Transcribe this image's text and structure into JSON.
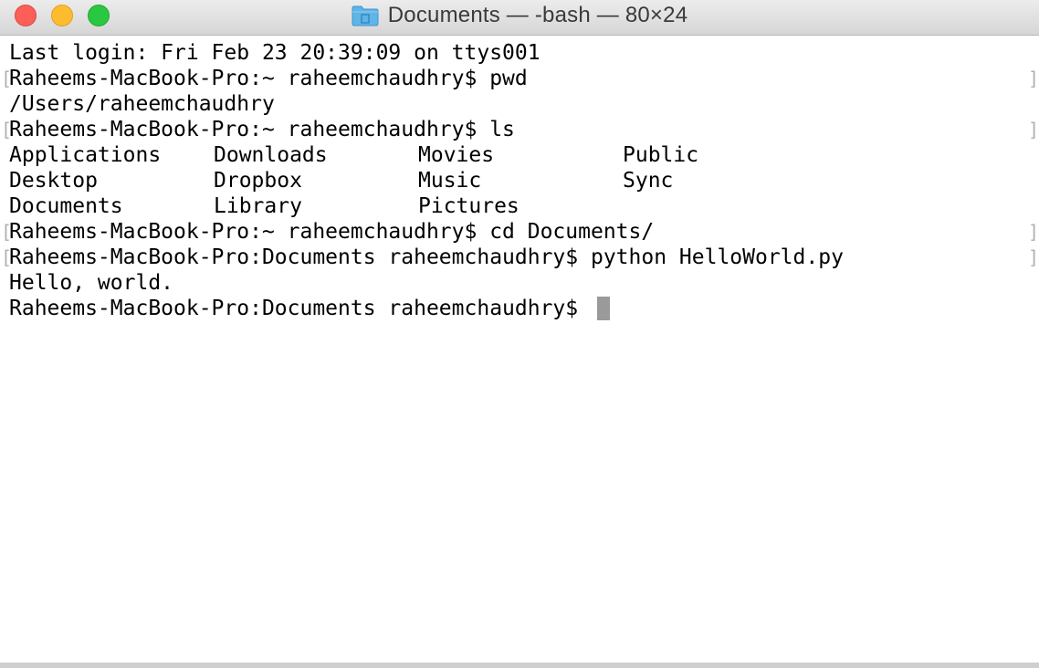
{
  "window": {
    "title": "Documents — -bash — 80×24",
    "folder_icon": "folder-icon"
  },
  "terminal": {
    "last_login": "Last login: Fri Feb 23 20:39:09 on ttys001",
    "cmd_pwd": "Raheems-MacBook-Pro:~ raheemchaudhry$ pwd",
    "pwd_output": "/Users/raheemchaudhry",
    "cmd_ls": "Raheems-MacBook-Pro:~ raheemchaudhry$ ls",
    "ls_output": [
      [
        "Applications",
        "Downloads",
        "Movies",
        "Public"
      ],
      [
        "Desktop",
        "Dropbox",
        "Music",
        "Sync"
      ],
      [
        "Documents",
        "Library",
        "Pictures",
        ""
      ]
    ],
    "cmd_cd": "Raheems-MacBook-Pro:~ raheemchaudhry$ cd Documents/",
    "cmd_python": "Raheems-MacBook-Pro:Documents raheemchaudhry$ python HelloWorld.py",
    "python_output": "Hello, world.",
    "current_prompt": "Raheems-MacBook-Pro:Documents raheemchaudhry$ ",
    "mark_left": "[",
    "mark_right": "]"
  },
  "colors": {
    "close": "#fc5f57",
    "minimize": "#fdbc2e",
    "zoom": "#28c840",
    "cursor": "#9a9a9a"
  }
}
